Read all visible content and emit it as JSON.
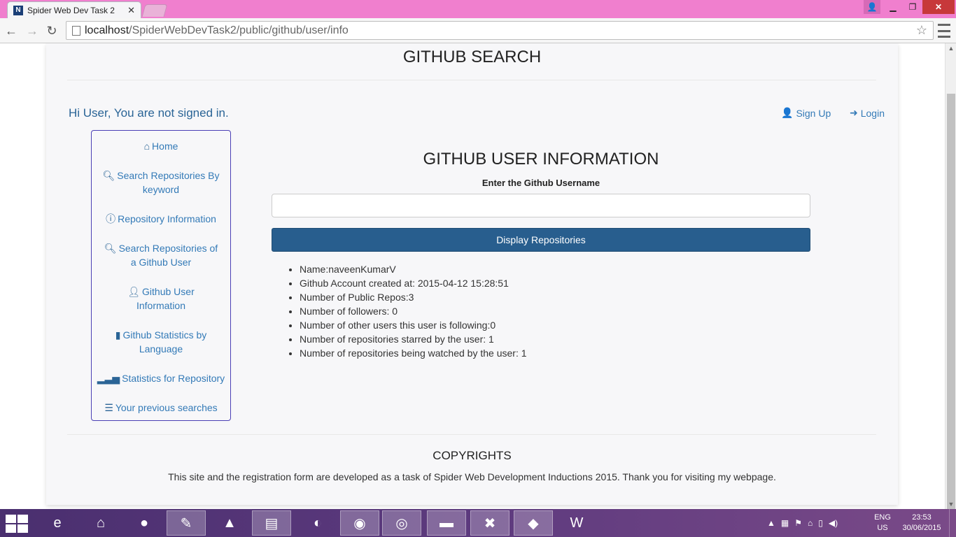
{
  "browser": {
    "tab_title": "Spider Web Dev Task 2",
    "favicon_letter": "N",
    "url_host": "localhost",
    "url_path": "/SpiderWebDevTask2/public/github/user/info"
  },
  "header": {
    "site_title": "GITHUB SEARCH",
    "greeting": "Hi User, You are not signed in.",
    "signup_label": "Sign Up",
    "login_label": "Login"
  },
  "sidebar": {
    "items": [
      {
        "label": "Home",
        "icon": "home-icon"
      },
      {
        "label": "Search Repositories By keyword",
        "icon": "search-icon"
      },
      {
        "label": "Repository Information",
        "icon": "info-icon"
      },
      {
        "label": "Search Repositories of a Github User",
        "icon": "search-icon"
      },
      {
        "label": "Github User Information",
        "icon": "user-icon"
      },
      {
        "label": "Github Statistics by Language",
        "icon": "bar-chart-icon"
      },
      {
        "label": "Statistics for Repository",
        "icon": "signal-icon"
      },
      {
        "label": "Your previous searches",
        "icon": "list-icon"
      }
    ]
  },
  "main": {
    "title": "GITHUB USER INFORMATION",
    "input_label": "Enter the Github Username",
    "input_value": "",
    "button_label": "Display Repositories",
    "info": [
      "Name:naveenKumarV",
      "Github Account created at: 2015-04-12 15:28:51",
      "Number of Public Repos:3",
      "Number of followers: 0",
      "Number of other users this user is following:0",
      "Number of repositories starred by the user: 1",
      "Number of repositories being watched by the user: 1"
    ]
  },
  "footer": {
    "title": "COPYRIGHTS",
    "text": "This site and the registration form are developed as a task of Spider Web Development Inductions 2015. Thank you for visiting my webpage."
  },
  "taskbar": {
    "lang_line1": "ENG",
    "lang_line2": "US",
    "time": "23:53",
    "date": "30/06/2015"
  },
  "colors": {
    "titlebar": "#f07fce",
    "link": "#337ab7",
    "button": "#285e8e",
    "nav_border": "#4a3fb5"
  }
}
